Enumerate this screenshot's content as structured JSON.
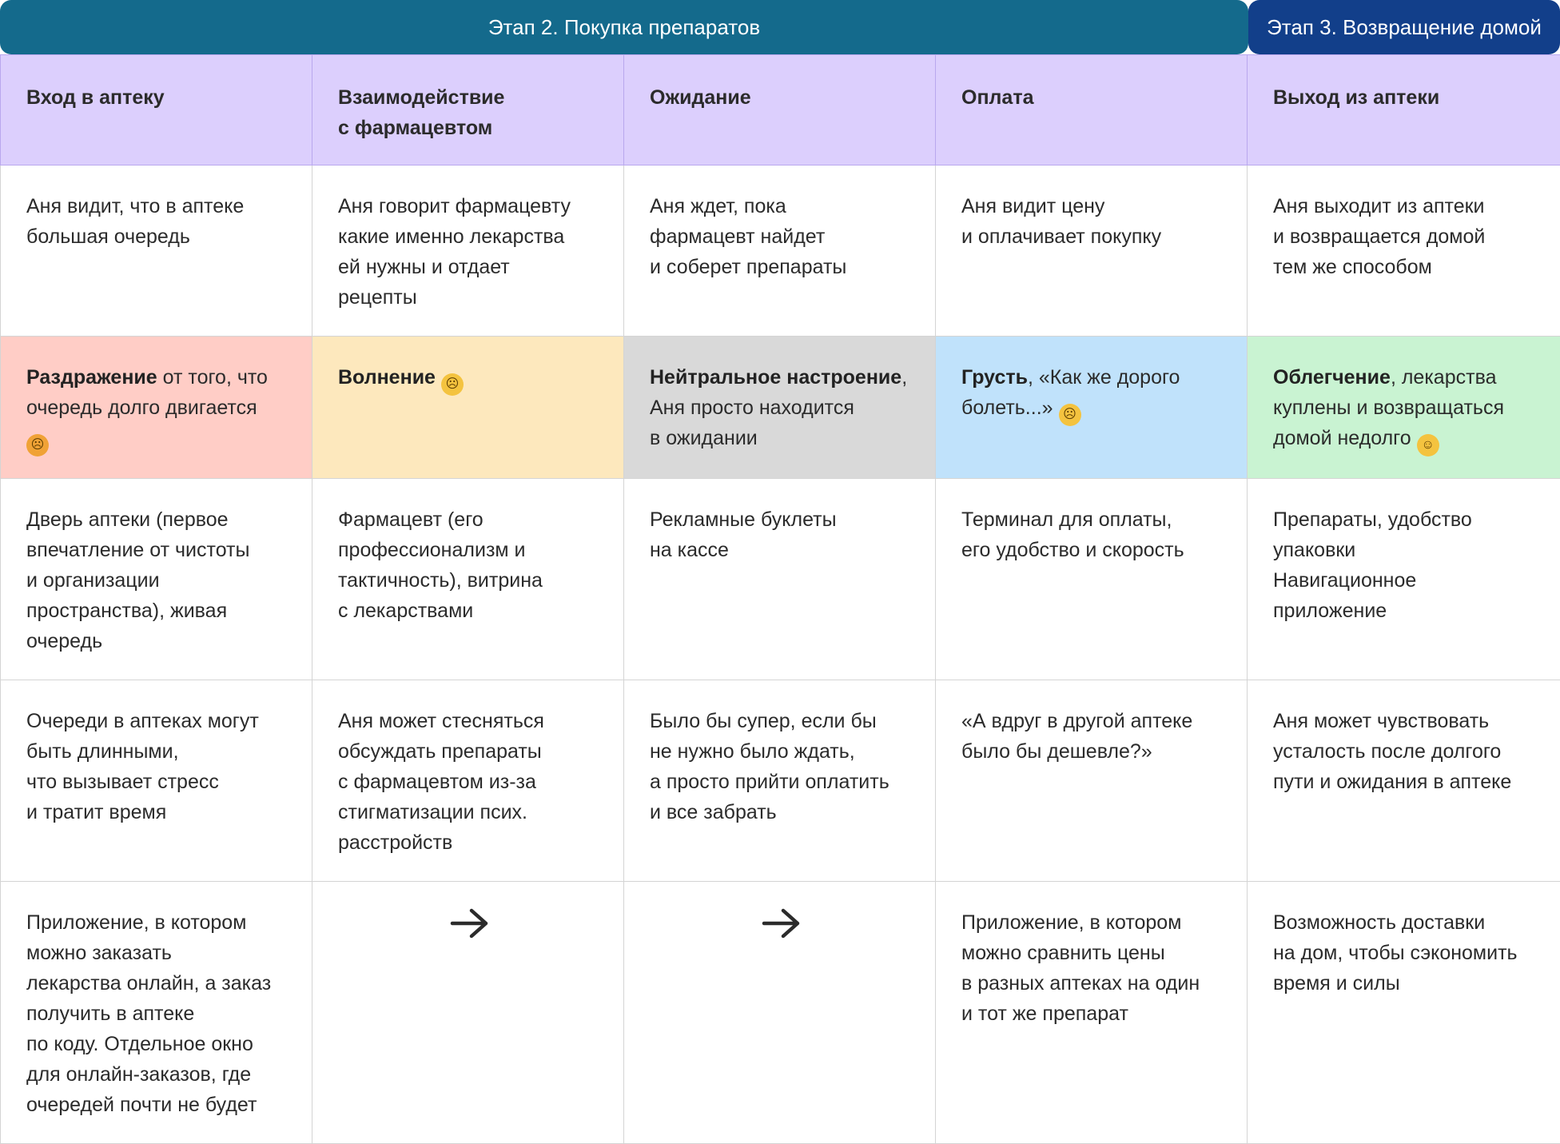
{
  "stages": {
    "stage2": "Этап 2. Покупка препаратов",
    "stage3": "Этап 3. Возвращение домой"
  },
  "columns": [
    "Вход в аптеку",
    [
      "Взаимодействие",
      "с фармацевтом"
    ],
    "Ожидание",
    "Оплата",
    "Выход из аптеки"
  ],
  "actions": [
    [
      "Аня видит, что в аптеке",
      "большая очередь"
    ],
    [
      "Аня говорит фармацевту",
      "какие именно лекарства",
      "ей нужны и отдает",
      "рецепты"
    ],
    [
      "Аня ждет, пока",
      "фармацевт найдет",
      "и соберет препараты"
    ],
    [
      "Аня видит цену",
      "и оплачивает покупку"
    ],
    [
      "Аня выходит из аптеки",
      "и возвращается домой",
      "тем же способом"
    ]
  ],
  "emotions": [
    {
      "bold": "Раздражение",
      "l1": " от того, что",
      "l2": "очередь долго двигается",
      "l3": "",
      "emoji": "angry-face-icon",
      "color": "#ffcdc6"
    },
    {
      "bold": "Волнение",
      "l1": "",
      "l2": "",
      "l3": "",
      "emoji": "persevering-face-icon",
      "color": "#fde8bd"
    },
    {
      "bold": "Нейтральное настроение",
      "l1": ",",
      "l2": "Аня просто находится",
      "l3": "в ожидании",
      "emoji": "",
      "color": "#d9d9d9"
    },
    {
      "bold": "Грусть",
      "l1": ", «Как же дорого",
      "l2": "болеть...»",
      "l3": "",
      "emoji": "crying-face-icon",
      "color": "#c0e2fb"
    },
    {
      "bold": "Облегчение",
      "l1": ", лекарства",
      "l2": "куплены и возвращаться",
      "l3": "домой недолго",
      "emoji": "relieved-face-icon",
      "color": "#c9f3d2"
    }
  ],
  "touchpoints": [
    [
      "Дверь аптеки (первое",
      "впечатление от чистоты",
      "и организации",
      "пространства), живая",
      "очередь"
    ],
    [
      "Фармацевт (его",
      "профессионализм и",
      "тактичность), витрина",
      "с лекарствами"
    ],
    [
      "Рекламные буклеты",
      "на кассе"
    ],
    [
      "Терминал для оплаты,",
      "его удобство и скорость"
    ],
    [
      "Препараты, удобство",
      "упаковки",
      "Навигационное",
      "приложение"
    ]
  ],
  "pains": [
    [
      "Очереди в аптеках могут",
      "быть длинными,",
      "что вызывает стресс",
      "и тратит время"
    ],
    [
      "Аня может стесняться",
      "обсуждать препараты",
      "с фармацевтом из-за",
      "стигматизации псих.",
      "расстройств"
    ],
    [
      "Было бы супер, если бы",
      "не нужно было ждать,",
      "а просто прийти оплатить",
      "и все забрать"
    ],
    [
      "«А вдруг в другой аптеке",
      "было бы дешевле?»"
    ],
    [
      "Аня может чувствовать",
      "усталость после долгого",
      "пути и ожидания в аптеке"
    ]
  ],
  "ideas": [
    [
      "Приложение, в котором",
      "можно заказать",
      "лекарства онлайн, а заказ",
      "получить в аптеке",
      "по коду. Отдельное окно",
      "для онлайн-заказов, где",
      "очередей почти не будет"
    ],
    "arrow-right-icon",
    "arrow-right-icon",
    [
      "Приложение, в котором",
      "можно сравнить цены",
      "в разных аптеках на один",
      "и тот же препарат"
    ],
    [
      "Возможность доставки",
      "на дом, чтобы сэкономить",
      "время и силы"
    ]
  ]
}
